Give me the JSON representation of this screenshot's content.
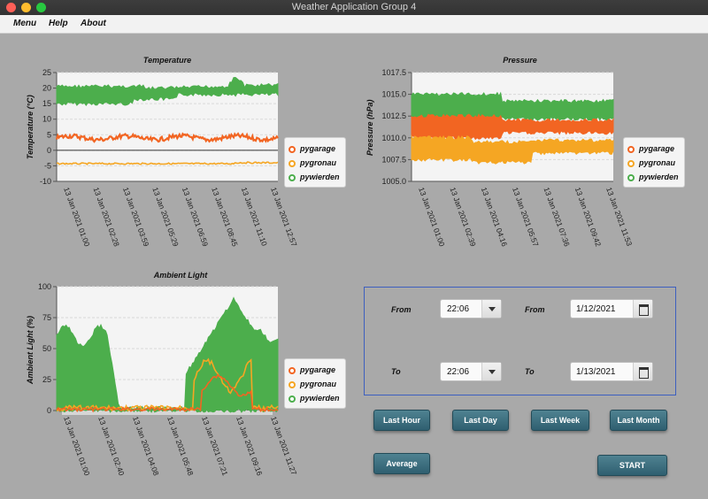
{
  "window": {
    "title": "Weather Application Group 4"
  },
  "menu": {
    "items": [
      "Menu",
      "Help",
      "About"
    ]
  },
  "charts": {
    "temperature": {
      "title": "Temperature",
      "ylabel": "Temperature (°C)",
      "yticks": [
        "25",
        "20",
        "15",
        "10",
        "5",
        "0",
        "-5",
        "-10"
      ],
      "xticks": [
        "13 Jan 2021 01:00",
        "13 Jan 2021 02:28",
        "13 Jan 2021 03:59",
        "13 Jan 2021 05:29",
        "13 Jan 2021 06:59",
        "13 Jan 2021 08:45",
        "13 Jan 2021 11:10",
        "13 Jan 2021 12:57"
      ]
    },
    "pressure": {
      "title": "Pressure",
      "ylabel": "Pressure (hPa)",
      "yticks": [
        "1017.5",
        "1015.0",
        "1012.5",
        "1010.0",
        "1007.5",
        "1005.0"
      ],
      "xticks": [
        "13 Jan 2021 01:00",
        "13 Jan 2021 02:39",
        "13 Jan 2021 04:16",
        "13 Jan 2021 05:57",
        "13 Jan 2021 07:36",
        "13 Jan 2021 09:42",
        "13 Jan 2021 11:53"
      ]
    },
    "light": {
      "title": "Ambient Light",
      "ylabel": "Ambient Light (%)",
      "yticks": [
        "100",
        "75",
        "50",
        "25",
        "0"
      ],
      "xticks": [
        "13 Jan 2021 01:00",
        "13 Jan 2021 02:40",
        "13 Jan 2021 04:08",
        "13 Jan 2021 05:48",
        "13 Jan 2021 07:21",
        "13 Jan 2021 09:16",
        "13 Jan 2021 11:27"
      ]
    }
  },
  "legend": {
    "series": [
      {
        "name": "pygarage",
        "color": "#f26522"
      },
      {
        "name": "pygronau",
        "color": "#f5a623"
      },
      {
        "name": "pywierden",
        "color": "#4cae4c"
      }
    ]
  },
  "range": {
    "from_label": "From",
    "to_label": "To",
    "from_time": "22:06",
    "to_time": "22:06",
    "from_date": "1/12/2021",
    "to_date": "1/13/2021"
  },
  "buttons": {
    "last_hour": "Last Hour",
    "last_day": "Last Day",
    "last_week": "Last Week",
    "last_month": "Last Month",
    "average": "Average",
    "start": "START"
  }
}
